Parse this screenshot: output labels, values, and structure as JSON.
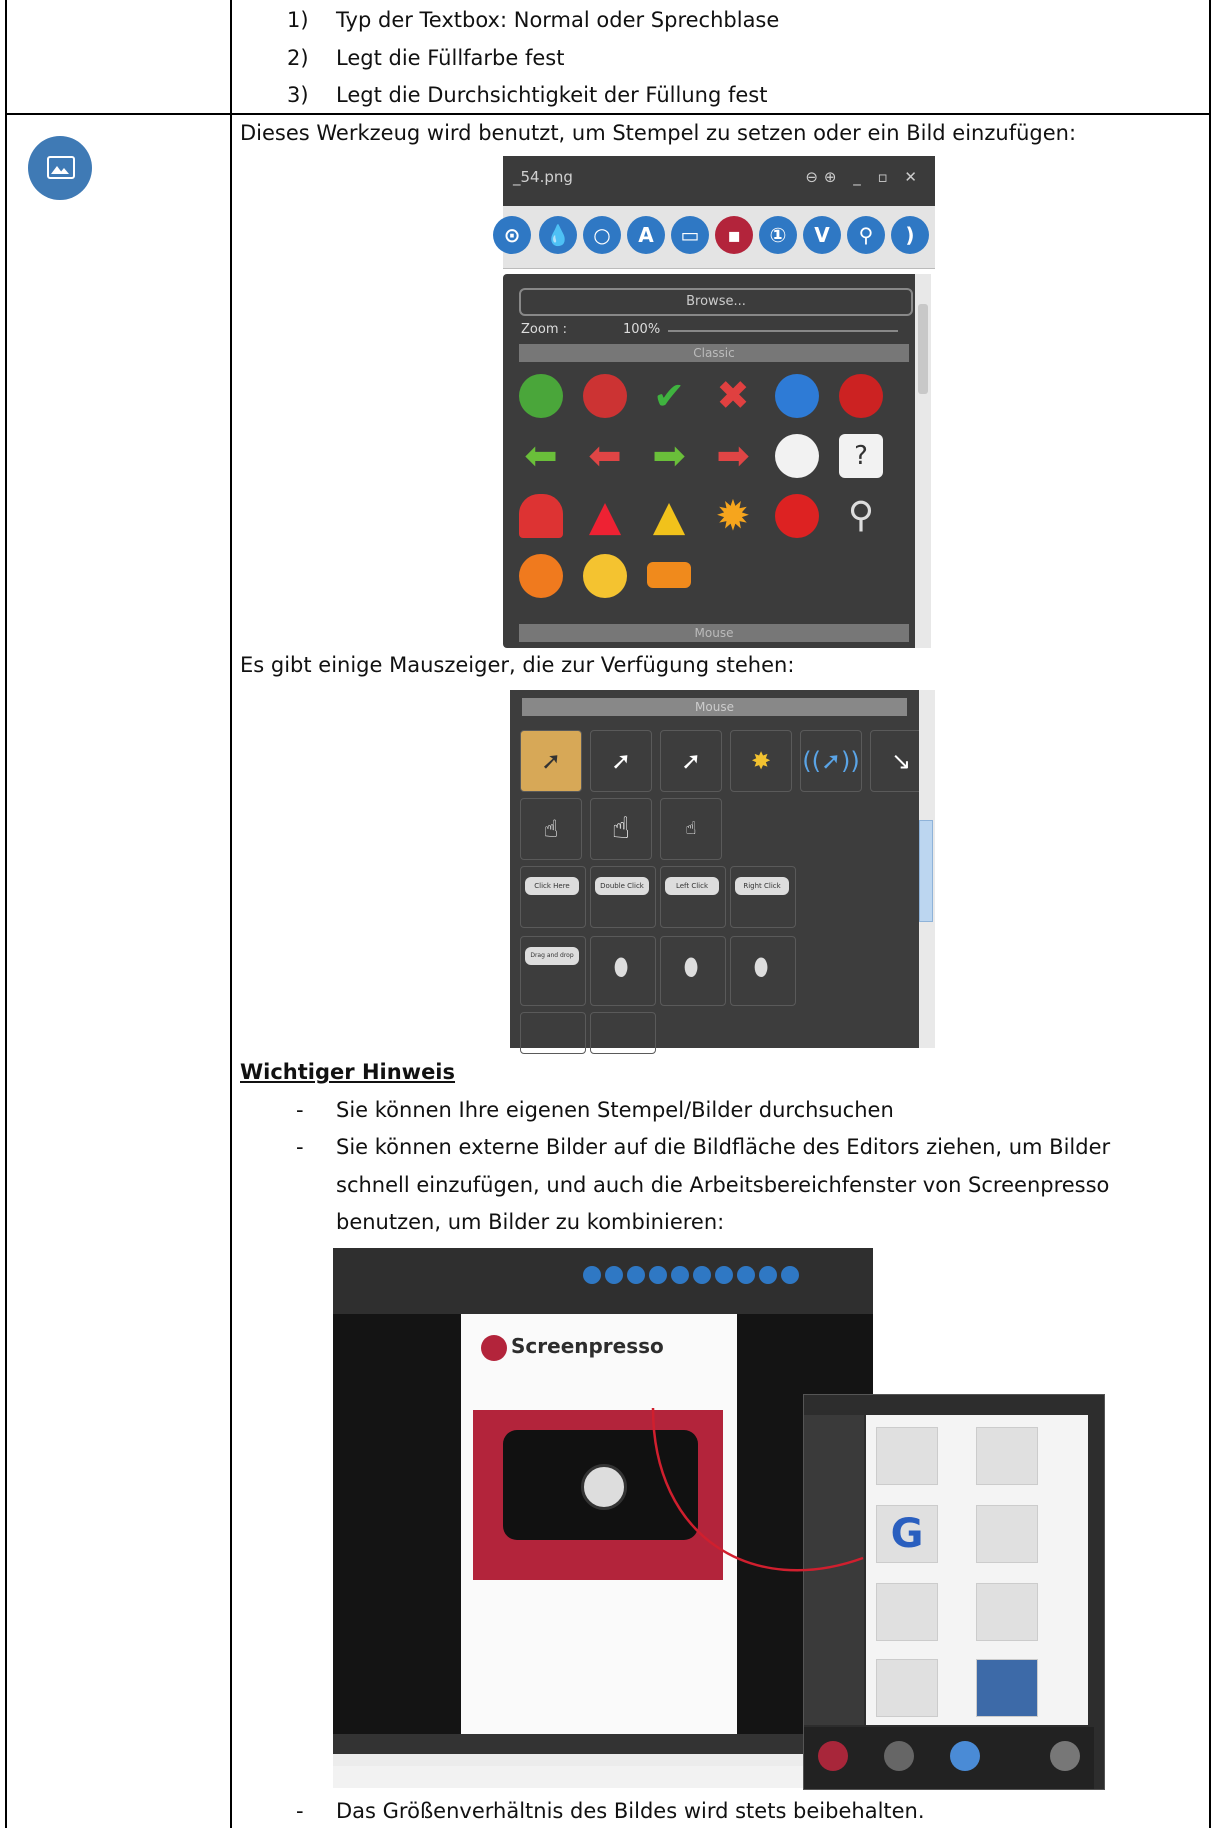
{
  "intro_list": [
    {
      "num": "1)",
      "text": "Typ der Textbox: Normal oder Sprechblase"
    },
    {
      "num": "2)",
      "text": "Legt die Füllfarbe fest"
    },
    {
      "num": "3)",
      "text": "Legt die Durchsichtigkeit der Füllung fest"
    }
  ],
  "tool_row": {
    "icon": "image-icon",
    "description": "Dieses Werkzeug wird benutzt, um Stempel zu setzen oder ein Bild einzufügen:",
    "cursor_intro": "Es gibt einige Mauszeiger, die zur Verfügung stehen:",
    "important_heading": "Wichtiger Hinweis",
    "notes": [
      "Sie können Ihre eigenen Stempel/Bilder durchsuchen",
      "Sie können externe Bilder auf die Bildfläche des Editors ziehen, um Bilder",
      "schnell einzufügen, und auch die Arbeitsbereichfenster von Screenpresso",
      "benutzen, um Bilder zu kombinieren:"
    ],
    "final_note": "Das Größenverhältnis des Bildes wird stets beibehalten.",
    "dash": "-"
  },
  "stamp_panel": {
    "window_title": "_54.png",
    "browse_label": "Browse...",
    "zoom_label": "Zoom :",
    "zoom_value": "100%",
    "category_classic": "Classic",
    "category_mouse": "Mouse"
  },
  "cursor_panel": {
    "category_mouse": "Mouse",
    "bubbles": [
      "Click Here",
      "Double Click",
      "Left Click",
      "Right Click"
    ],
    "drag_bubble": "Drag and drop"
  },
  "composite": {
    "logo_text": "Screenpresso"
  }
}
